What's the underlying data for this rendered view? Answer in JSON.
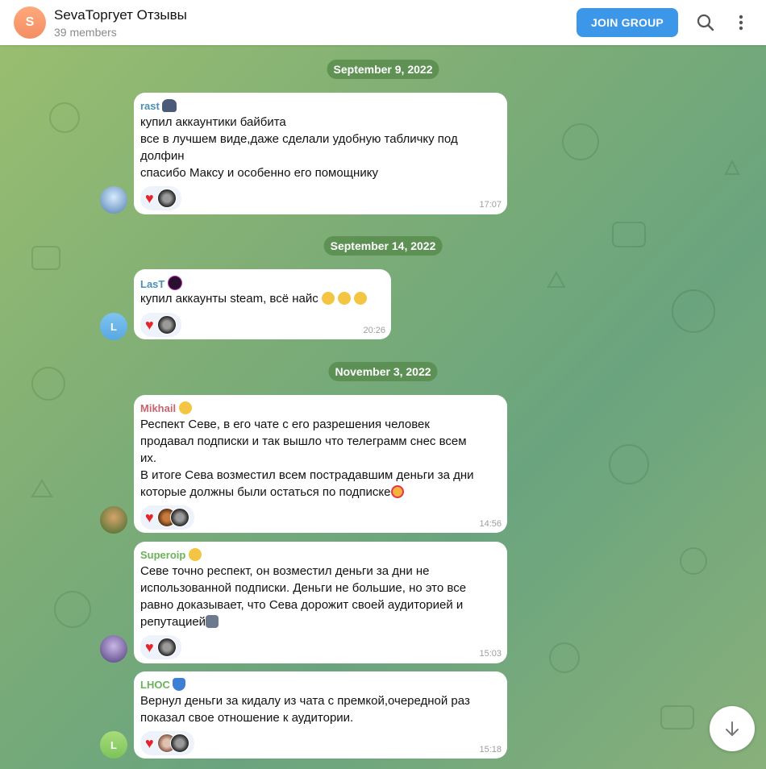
{
  "header": {
    "avatar_letter": "S",
    "title": "SevaТоргует Отзывы",
    "members": "39 members",
    "join_label": "JOIN GROUP",
    "search_icon": "search-icon",
    "menu_icon": "more-vertical-icon"
  },
  "dates": [
    "September 9, 2022",
    "September 14, 2022",
    "November 3, 2022"
  ],
  "messages": [
    {
      "author": "rast",
      "author_color": "#4a90b8",
      "lines": [
        "купил аккаунтики байбита",
        "все в лучшем виде,даже сделали удобную табличку под",
        "долфин",
        "спасибо Максу и особенно его помощнику"
      ],
      "time": "17:07",
      "reactions": [
        "heart",
        "avatar"
      ]
    },
    {
      "author": "LasT",
      "author_color": "#4a90b8",
      "avatar_letter": "L",
      "lines": [
        "купил аккаунты steam, всё найс"
      ],
      "time": "20:26",
      "reactions": [
        "heart",
        "avatar"
      ]
    },
    {
      "author": "Mikhail",
      "author_color": "#c86470",
      "lines": [
        "Респект Севе, в его чате с его разрешения человек",
        "продавал подписки и так вышло что телеграмм снес всем",
        "их.",
        "В итоге Сева возместил всем пострадавшим деньги за дни",
        "которые должны были остаться по подписке"
      ],
      "time": "14:56",
      "reactions": [
        "heart",
        "avatar",
        "avatar"
      ]
    },
    {
      "author": "Superoip",
      "author_color": "#6bb35a",
      "lines": [
        "Севе точно респект, он возместил деньги за дни не",
        "использованной подписки. Деньги не большие, но это все",
        "равно доказывает, что Сева дорожит своей аудиторией и",
        "репутацией"
      ],
      "time": "15:03",
      "reactions": [
        "heart",
        "avatar"
      ]
    },
    {
      "author": "LHOC",
      "author_color": "#6bb35a",
      "avatar_letter": "L",
      "lines": [
        "Вернул деньги за кидалу из чата с премкой,очередной раз",
        "показал свое отношение к аудитории."
      ],
      "time": "15:18",
      "reactions": [
        "heart",
        "avatar",
        "avatar"
      ]
    }
  ],
  "scroll_down_icon": "arrow-down-icon"
}
